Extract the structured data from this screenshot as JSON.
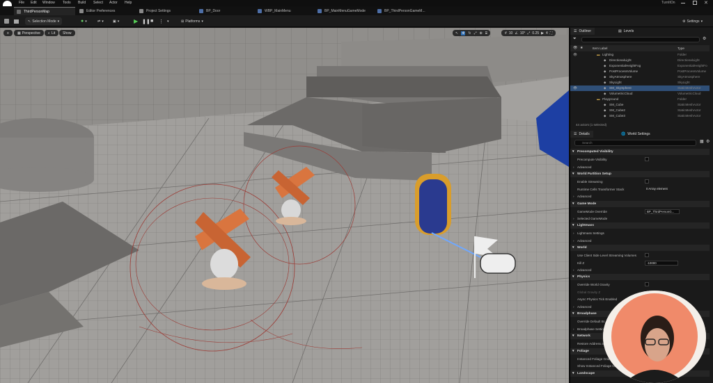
{
  "menubar": {
    "items": [
      "File",
      "Edit",
      "Window",
      "Tools",
      "Build",
      "Select",
      "Actor",
      "Help"
    ],
    "user": "TurnItOn"
  },
  "tabs": [
    "ThirdPersonMap",
    "Editor Preferences",
    "Project Settings",
    "BP_Door",
    "WBP_MainMenu",
    "BP_MainMenuGameMode",
    "BP_ThirdPersonGameM..."
  ],
  "toolbar": {
    "selection_mode": "Selection Mode",
    "platforms": "Platforms",
    "settings": "Settings"
  },
  "viewport": {
    "perspective": "Perspective",
    "lit": "Lit",
    "show": "Show",
    "grid_snap": "10",
    "rot_snap": "10°",
    "scale_snap": "0.25",
    "cam_speed": "4"
  },
  "outliner": {
    "tab": "Outliner",
    "tab2": "Levels",
    "col_label": "Item Label",
    "col_type": "Type",
    "rows": [
      {
        "label": "Lighting",
        "type": "Folder",
        "indent": 0
      },
      {
        "label": "DirectionalLight",
        "type": "DirectionalLight",
        "indent": 1
      },
      {
        "label": "ExponentialHeightFog",
        "type": "ExponentialHeightFo",
        "indent": 1
      },
      {
        "label": "PostProcessVolume",
        "type": "PostProcessVolume",
        "indent": 1
      },
      {
        "label": "SkyAtmosphere",
        "type": "SkyAtmosphere",
        "indent": 1
      },
      {
        "label": "SkyLight",
        "type": "SkyLight",
        "indent": 1
      },
      {
        "label": "SM_SkySphere",
        "type": "StaticMeshActor",
        "indent": 1
      },
      {
        "label": "VolumetricCloud",
        "type": "VolumetricCloud",
        "indent": 1
      },
      {
        "label": "Playground",
        "type": "Folder",
        "indent": 0
      },
      {
        "label": "SM_Cube",
        "type": "StaticMeshActor",
        "indent": 1
      },
      {
        "label": "SM_Cube2",
        "type": "StaticMeshActor",
        "indent": 1
      },
      {
        "label": "SM_Cube3",
        "type": "StaticMeshActor",
        "indent": 1
      }
    ],
    "status": "44 actors (1 selected)"
  },
  "details": {
    "tab": "Details",
    "tab2": "World Settings",
    "search_placeholder": "Search",
    "sections": [
      {
        "title": "Precomputed Visibility",
        "props": [
          {
            "label": "Precompute Visibility",
            "kind": "check"
          },
          {
            "label": "Advanced",
            "kind": "adv"
          }
        ]
      },
      {
        "title": "World Partition Setup",
        "props": [
          {
            "label": "Enable Streaming",
            "kind": "check"
          },
          {
            "label": "Runtime Cells Transformer Stack",
            "kind": "text",
            "value": "0 Array element"
          },
          {
            "label": "Advanced",
            "kind": "adv"
          }
        ]
      },
      {
        "title": "Game Mode",
        "props": [
          {
            "label": "GameMode Override",
            "kind": "field",
            "value": "BP_ThirdPersonG..."
          },
          {
            "label": "Selected GameMode",
            "kind": "adv"
          }
        ]
      },
      {
        "title": "Lightmass",
        "props": [
          {
            "label": "Lightmass Settings",
            "kind": "adv"
          },
          {
            "label": "Advanced",
            "kind": "adv"
          }
        ]
      },
      {
        "title": "World",
        "props": [
          {
            "label": "Use Client Side Level Streaming Volumes",
            "kind": "check"
          },
          {
            "label": "Kill Z",
            "kind": "field",
            "value": "-10000"
          },
          {
            "label": "Advanced",
            "kind": "adv"
          }
        ]
      },
      {
        "title": "Physics",
        "props": [
          {
            "label": "Override World Gravity",
            "kind": "check"
          },
          {
            "label": "Global Gravity Z",
            "kind": "dim"
          },
          {
            "label": "Async Physics Tick Enabled",
            "kind": "check"
          },
          {
            "label": "Advanced",
            "kind": "adv"
          }
        ]
      },
      {
        "title": "Broadphase",
        "props": [
          {
            "label": "Override Default Br...",
            "kind": "plain"
          },
          {
            "label": "Broadphase Settings",
            "kind": "adv"
          }
        ]
      },
      {
        "title": "Network",
        "props": [
          {
            "label": "Restore Address and...",
            "kind": "plain"
          }
        ]
      },
      {
        "title": "Foliage",
        "props": [
          {
            "label": "Instanced Foliage Grid...",
            "kind": "plain"
          },
          {
            "label": "Show Instanced Foliage G...",
            "kind": "plain"
          }
        ]
      },
      {
        "title": "Landscape",
        "props": []
      }
    ]
  },
  "colors": {
    "accent": "#2f6fb5",
    "selection": "#2f4f77",
    "webcam_bg": "#f08a6a"
  }
}
